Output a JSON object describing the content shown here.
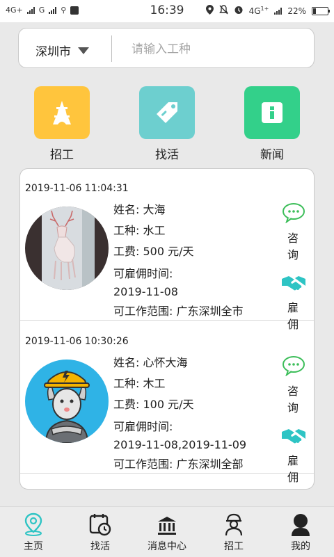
{
  "status_bar": {
    "left_labels": [
      "4G+",
      "G"
    ],
    "time": "16:39",
    "right_network": "4G",
    "right_network_sup": "1+",
    "battery_text": "22%",
    "battery_level": 0.22
  },
  "search": {
    "city": "深圳市",
    "placeholder": "请输入工种",
    "value": ""
  },
  "categories": [
    {
      "label": "招工",
      "icon": "tower-icon",
      "color": "#FFC53D"
    },
    {
      "label": "找活",
      "icon": "tag-icon",
      "color": "#6DCFCF"
    },
    {
      "label": "新闻",
      "icon": "news-icon",
      "color": "#33D08A"
    }
  ],
  "workers": [
    {
      "time": "2019-11-06 11:04:31",
      "name_label": "姓名:",
      "name": "大海",
      "type_label": "工种:",
      "type": "水工",
      "wage_label": "工费:",
      "wage": "500 元/天",
      "hire_label": "可雇佣时间:",
      "hire": "2019-11-08",
      "area_label": "可工作范围:",
      "area": "广东深圳全市",
      "consult": "咨 询",
      "employ": "雇 佣"
    },
    {
      "time": "2019-11-06 10:30:26",
      "name_label": "姓名:",
      "name": "心怀大海",
      "type_label": "工种:",
      "type": "木工",
      "wage_label": "工费:",
      "wage": "100 元/天",
      "hire_label": "可雇佣时间:",
      "hire": "2019-11-08,2019-11-09",
      "area_label": "可工作范围:",
      "area": "广东深圳全部",
      "consult": "咨 询",
      "employ": "雇 佣"
    }
  ],
  "tabs": [
    {
      "label": "主页",
      "icon": "home-location-icon",
      "active": true
    },
    {
      "label": "找活",
      "icon": "schedule-icon",
      "active": false
    },
    {
      "label": "消息中心",
      "icon": "bank-icon",
      "active": false
    },
    {
      "label": "招工",
      "icon": "worker-icon",
      "active": false
    },
    {
      "label": "我的",
      "icon": "user-icon",
      "active": false
    }
  ],
  "colors": {
    "accent": "#2EC4C4",
    "chat_green": "#3DBE5A"
  }
}
